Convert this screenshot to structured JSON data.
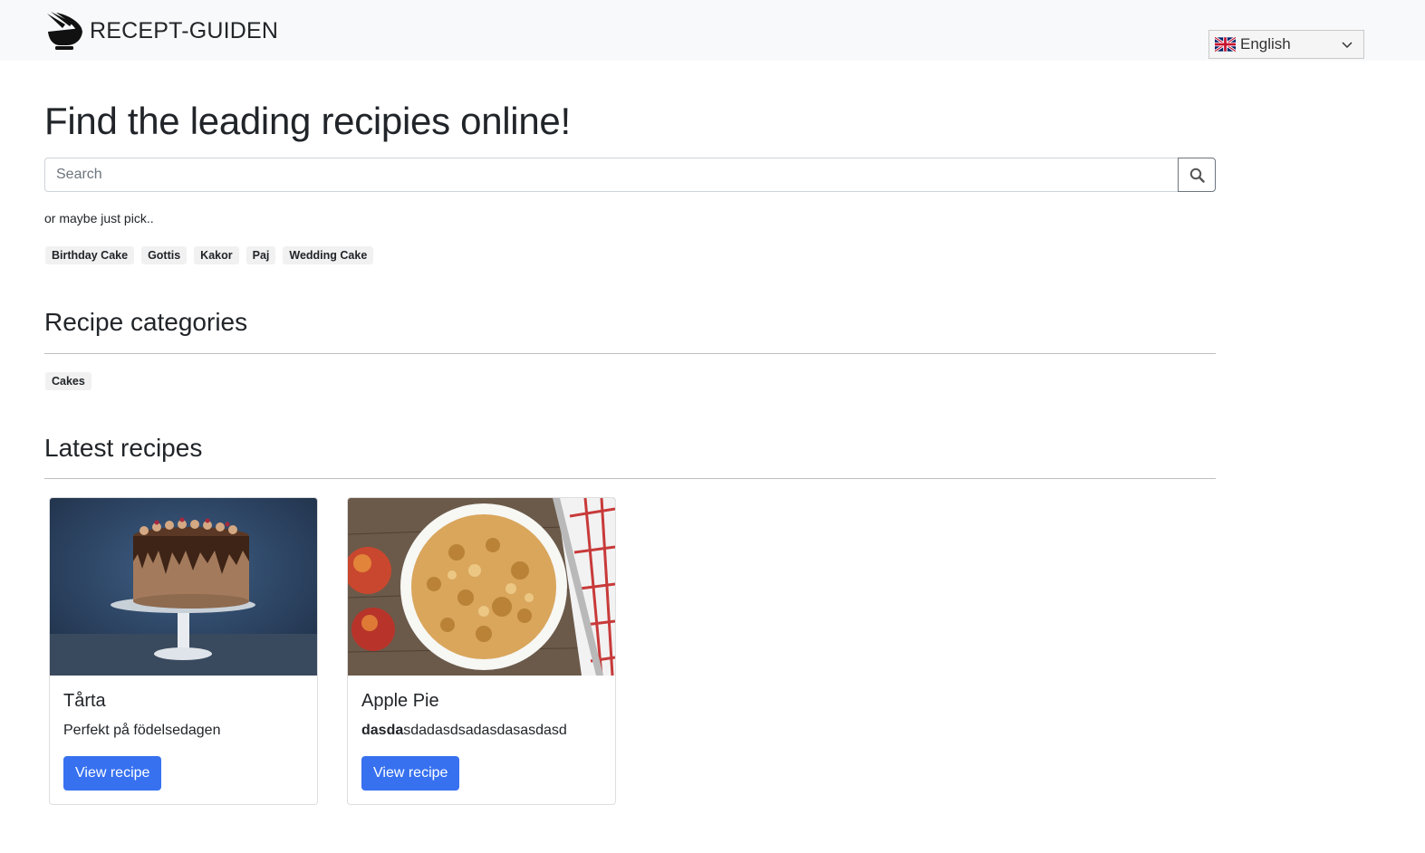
{
  "header": {
    "brand": "RECEPT-GUIDEN",
    "language": {
      "selected": "English"
    }
  },
  "hero": {
    "title": "Find the leading recipies online!",
    "search_placeholder": "Search"
  },
  "quick_pick": {
    "intro": "or maybe just pick..",
    "tags": [
      "Birthday Cake",
      "Gottis",
      "Kakor",
      "Paj",
      "Wedding Cake"
    ]
  },
  "categories": {
    "title": "Recipe categories",
    "items": [
      "Cakes"
    ]
  },
  "latest": {
    "title": "Latest recipes",
    "cards": [
      {
        "title": "Tårta",
        "text": "Perfekt på födelsedagen",
        "button": "View recipe"
      },
      {
        "title": "Apple Pie",
        "text_bold": "dasda",
        "text": "sdadasdsadasdasasdasd",
        "button": "View recipe"
      }
    ]
  }
}
